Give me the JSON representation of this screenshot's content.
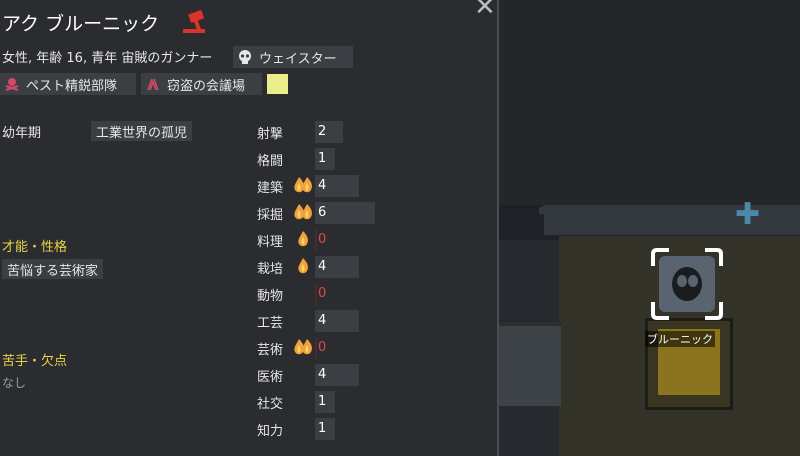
{
  "pawn": {
    "name": "アク ブルーニック",
    "subtitle": "女性, 年齢 16, 青年 宙賊のガンナー",
    "ideology": "ウェイスター",
    "faction": "ペスト精鋭部隊",
    "title": "窃盗の会議場"
  },
  "backstory": {
    "label": "幼年期",
    "value": "工業世界の孤児"
  },
  "traits": {
    "label": "才能・性格",
    "items": [
      "苦悩する芸術家"
    ]
  },
  "incapable": {
    "label": "苦手・欠点",
    "value": "なし"
  },
  "skills": [
    {
      "name": "射撃",
      "level": 2,
      "passion": "none"
    },
    {
      "name": "格闘",
      "level": 1,
      "passion": "none"
    },
    {
      "name": "建築",
      "level": 4,
      "passion": "major"
    },
    {
      "name": "採掘",
      "level": 6,
      "passion": "major"
    },
    {
      "name": "料理",
      "level": 0,
      "passion": "minor"
    },
    {
      "name": "栽培",
      "level": 4,
      "passion": "minor"
    },
    {
      "name": "動物",
      "level": 0,
      "passion": "none"
    },
    {
      "name": "工芸",
      "level": 4,
      "passion": "none"
    },
    {
      "name": "芸術",
      "level": 0,
      "passion": "major"
    },
    {
      "name": "医術",
      "level": 4,
      "passion": "none"
    },
    {
      "name": "社交",
      "level": 1,
      "passion": "none"
    },
    {
      "name": "知力",
      "level": 1,
      "passion": "none"
    }
  ],
  "map": {
    "pawn_label": "ブルーニック"
  },
  "colors": {
    "accent_gold": "#e9d548",
    "zero_red": "#e04848",
    "faction_color": "#e9ee8a",
    "gavel_red": "#d8342c"
  }
}
